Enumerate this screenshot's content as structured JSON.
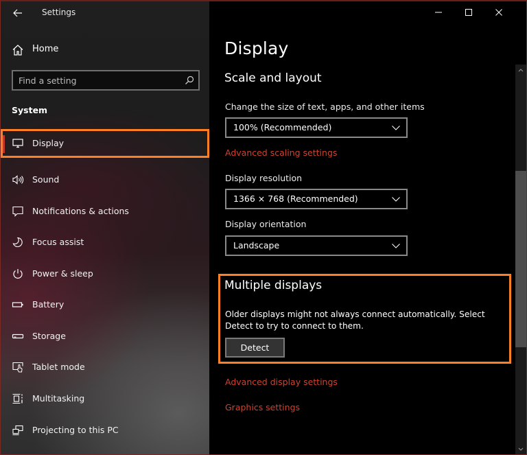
{
  "window": {
    "title": "Settings",
    "controls": {
      "minimize": "minimize-icon",
      "maximize": "maximize-icon",
      "close": "close-icon"
    }
  },
  "sidebar": {
    "back_icon": "arrow-left-icon",
    "home": {
      "label": "Home",
      "icon": "home-icon"
    },
    "search": {
      "placeholder": "Find a setting",
      "value": "",
      "icon": "search-icon"
    },
    "section_title": "System",
    "items": [
      {
        "label": "Display",
        "icon": "monitor-icon",
        "selected": true
      },
      {
        "label": "Sound",
        "icon": "speaker-icon",
        "selected": false
      },
      {
        "label": "Notifications & actions",
        "icon": "message-icon",
        "selected": false
      },
      {
        "label": "Focus assist",
        "icon": "moon-icon",
        "selected": false
      },
      {
        "label": "Power & sleep",
        "icon": "power-icon",
        "selected": false
      },
      {
        "label": "Battery",
        "icon": "battery-icon",
        "selected": false
      },
      {
        "label": "Storage",
        "icon": "storage-icon",
        "selected": false
      },
      {
        "label": "Tablet mode",
        "icon": "tablet-mode-icon",
        "selected": false
      },
      {
        "label": "Multitasking",
        "icon": "multitasking-icon",
        "selected": false
      },
      {
        "label": "Projecting to this PC",
        "icon": "projecting-icon",
        "selected": false
      }
    ]
  },
  "main": {
    "page_title": "Display",
    "scale_layout": {
      "heading": "Scale and layout",
      "size_label": "Change the size of text, apps, and other items",
      "size_value": "100% (Recommended)",
      "advanced_scaling_link": "Advanced scaling settings",
      "resolution_label": "Display resolution",
      "resolution_value": "1366 × 768 (Recommended)",
      "orientation_label": "Display orientation",
      "orientation_value": "Landscape"
    },
    "multiple_displays": {
      "heading": "Multiple displays",
      "description": "Older displays might not always connect automatically. Select Detect to try to connect to them.",
      "detect_button": "Detect"
    },
    "links": {
      "advanced_display": "Advanced display settings",
      "graphics": "Graphics settings"
    }
  },
  "colors": {
    "accent_link": "#d2412f",
    "highlight_outline": "#ff7f27",
    "background": "#000000"
  }
}
